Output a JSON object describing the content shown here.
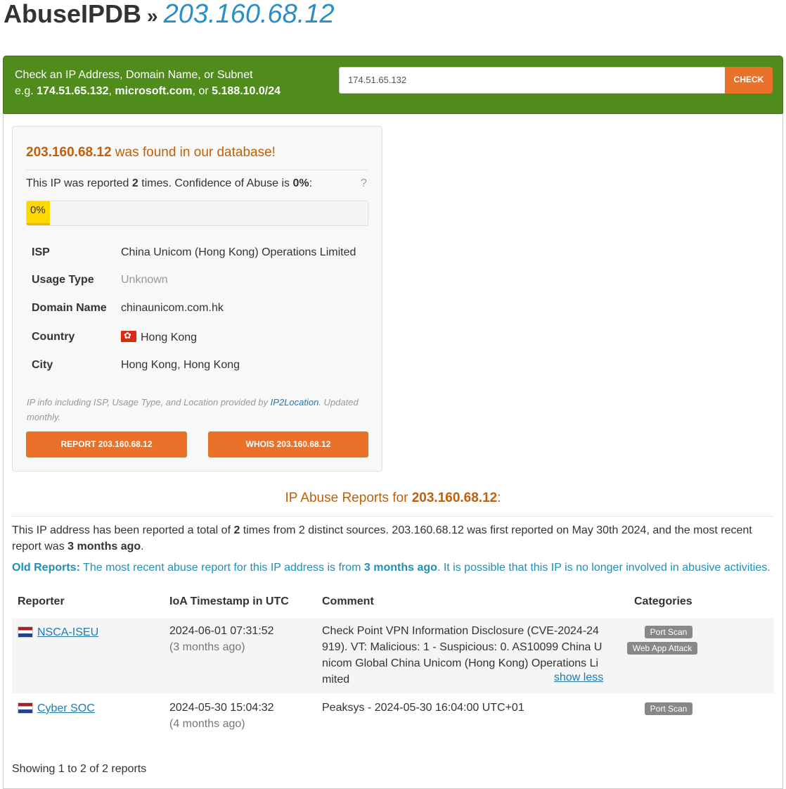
{
  "title": {
    "brand": "AbuseIPDB",
    "separator": "»",
    "ip": "203.160.68.12"
  },
  "search": {
    "hint_line1": "Check an IP Address, Domain Name, or Subnet",
    "hint_prefix": "e.g. ",
    "example_ip": "174.51.65.132",
    "comma": ", ",
    "example_domain": "microsoft.com",
    "or": ", or ",
    "example_subnet": "5.188.10.0/24",
    "value": "174.51.65.132",
    "check_label": "CHECK"
  },
  "result": {
    "ip": "203.160.68.12",
    "found_suffix": " was found in our database!",
    "reported_prefix": "This IP was reported ",
    "report_count": "2",
    "reported_mid": " times. Confidence of Abuse is ",
    "confidence": "0%",
    "reported_suffix": ":",
    "help": "?",
    "confidence_value": 0,
    "confidence_label": "0%"
  },
  "info": {
    "isp_label": "ISP",
    "isp": "China Unicom (Hong Kong) Operations Limited",
    "usage_label": "Usage Type",
    "usage": "Unknown",
    "domain_label": "Domain Name",
    "domain": "chinaunicom.com.hk",
    "country_label": "Country",
    "country": "Hong Kong",
    "city_label": "City",
    "city": "Hong Kong, Hong Kong"
  },
  "provider_note": {
    "prefix": "IP info including ISP, Usage Type, and Location provided by ",
    "link": "IP2Location",
    "suffix": ". Updated monthly."
  },
  "buttons": {
    "report": "REPORT 203.160.68.12",
    "whois": "WHOIS 203.160.68.12"
  },
  "reports": {
    "title_prefix": "IP Abuse Reports for ",
    "title_ip": "203.160.68.12",
    "title_suffix": ":",
    "summary_p1": "This IP address has been reported a total of ",
    "summary_count": "2",
    "summary_p2": " times from 2 distinct sources. 203.160.68.12 was first reported on May 30th 2024, and the most recent report was ",
    "summary_recent": "3 months ago",
    "summary_p3": ".",
    "old_label": "Old Reports:",
    "old_p1": " The most recent abuse report for this IP address is from ",
    "old_recent": "3 months ago",
    "old_p2": ". It is possible that this IP is no longer involved in abusive activities."
  },
  "table": {
    "headers": [
      "Reporter",
      "IoA Timestamp in UTC",
      "Comment",
      "Categories"
    ],
    "rows": [
      {
        "reporter": "NSCA-ISEU",
        "timestamp": "2024-06-01 07:31:52",
        "ago": "(3 months ago)",
        "comment_lines": [
          "Check Point VPN Information Disclosure (CVE-2024-24",
          "919). VT: Malicious: 1 - Suspicious: 0. AS10099 China U",
          "nicom Global China Unicom (Hong Kong) Operations Li",
          "mited"
        ],
        "toggle": "show less",
        "categories": [
          "Port Scan",
          "Web App Attack"
        ]
      },
      {
        "reporter": "Cyber SOC",
        "timestamp": "2024-05-30 15:04:32",
        "ago": "(4 months ago)",
        "comment_lines": [
          "Peaksys - 2024-05-30 16:04:00 UTC+01"
        ],
        "categories": [
          "Port Scan"
        ]
      }
    ]
  },
  "footer": {
    "showing": "Showing 1 to 2 of 2 reports"
  }
}
